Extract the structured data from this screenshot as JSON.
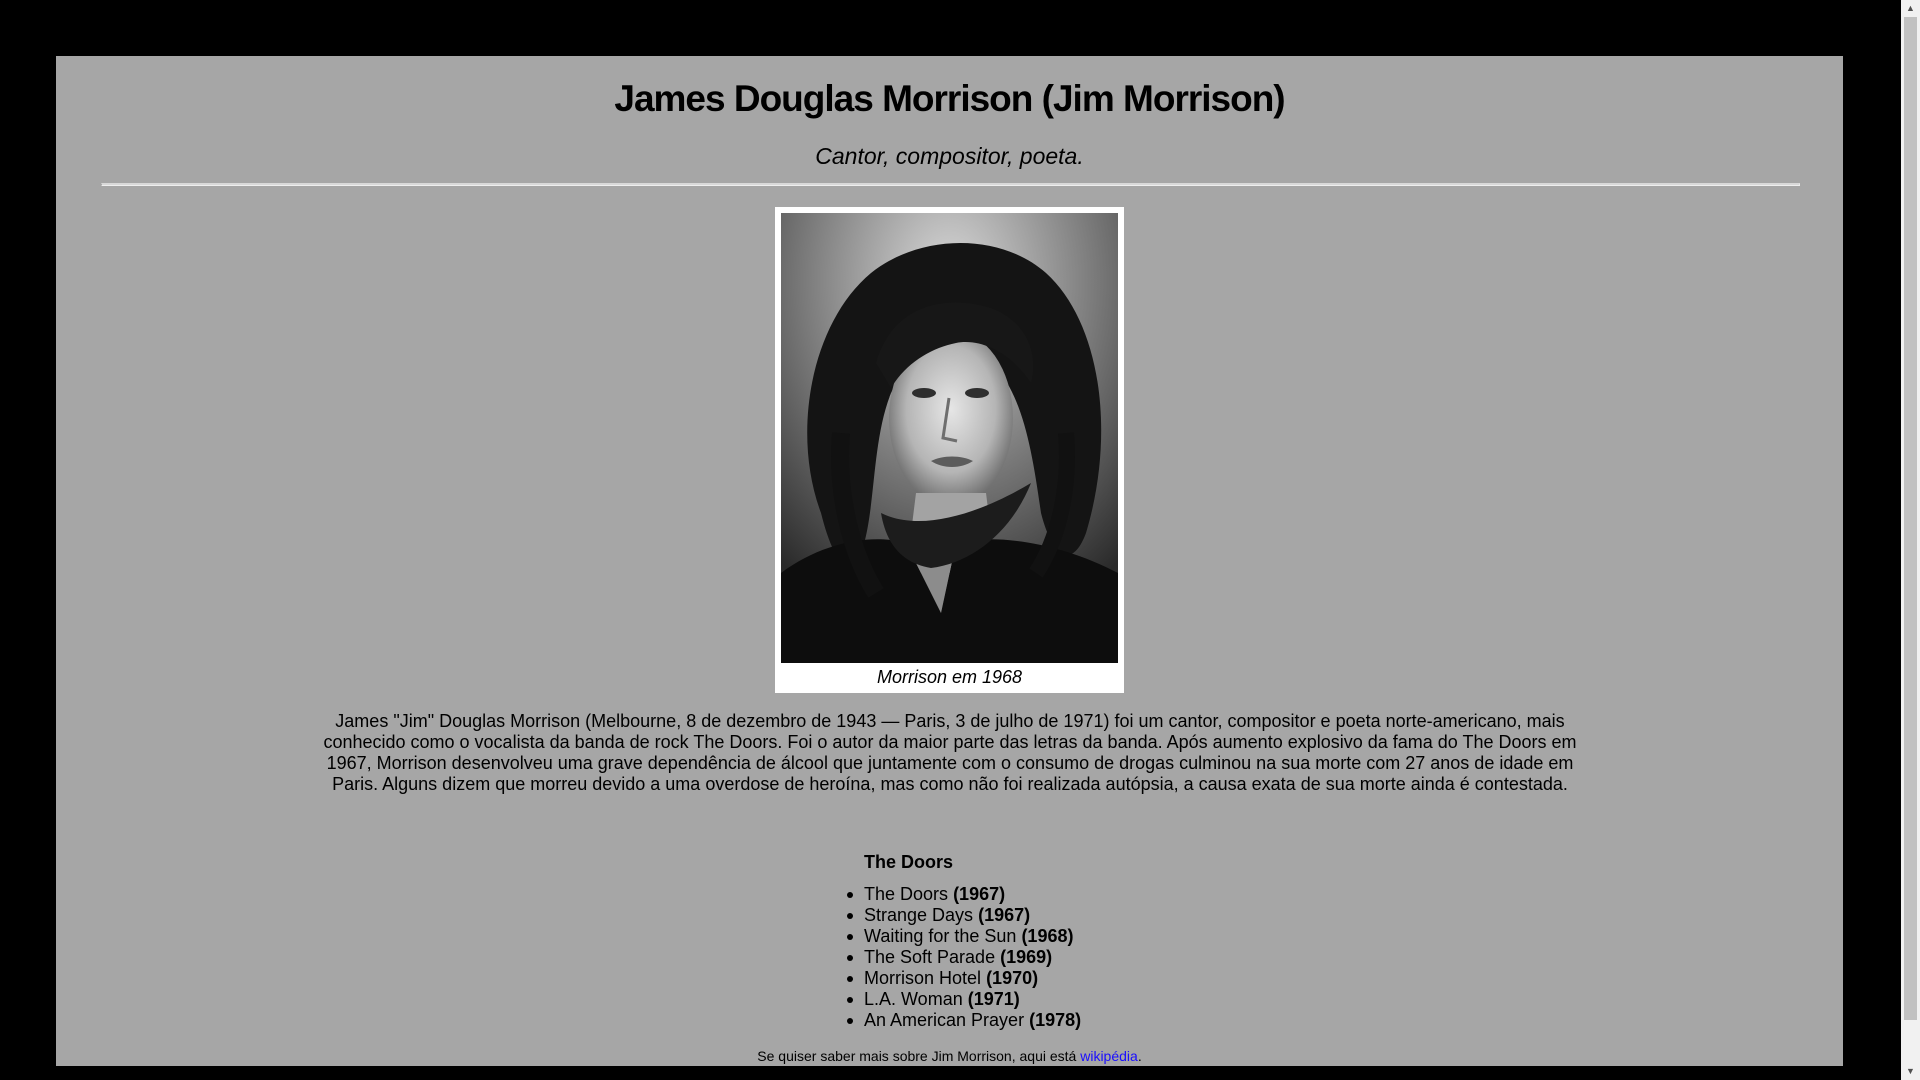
{
  "page": {
    "title": "James Douglas Morrison (Jim Morrison)",
    "subtitle": "Cantor, compositor, poeta."
  },
  "figure": {
    "caption": "Morrison em 1968",
    "image_alt": "Morrison em 1968"
  },
  "bio": {
    "text": "James \"Jim\" Douglas Morrison (Melbourne, 8 de dezembro de 1943 — Paris, 3 de julho de 1971) foi um cantor, compositor e poeta norte-americano, mais conhecido como o vocalista da banda de rock The Doors. Foi o autor da maior parte das letras da banda. Após aumento explosivo da fama do The Doors em 1967, Morrison desenvolveu uma grave dependência de álcool que juntamente com o consumo de drogas culminou na sua morte com 27 anos de idade em Paris. Alguns dizem que morreu devido a uma overdose de heroína, mas como não foi realizada autópsia, a causa exata de sua morte ainda é contestada."
  },
  "discography": {
    "heading": "The Doors",
    "albums": [
      {
        "name": "The Doors",
        "year": "(1967)"
      },
      {
        "name": "Strange Days",
        "year": "(1967)"
      },
      {
        "name": "Waiting for the Sun",
        "year": "(1968)"
      },
      {
        "name": "The Soft Parade",
        "year": "(1969)"
      },
      {
        "name": "Morrison Hotel",
        "year": "(1970)"
      },
      {
        "name": "L.A. Woman",
        "year": "(1971)"
      },
      {
        "name": "An American Prayer",
        "year": "(1978)"
      }
    ]
  },
  "footer": {
    "text": "Se quiser saber mais sobre Jim Morrison, aqui está ",
    "link_label": "wikipédia",
    "trailing": "."
  },
  "scrollbar": {
    "up_icon": "scroll-up-arrow-icon",
    "down_icon": "scroll-down-arrow-icon"
  },
  "colors": {
    "background": "#000000",
    "panel": "#a6a6a6",
    "link": "#1a0dff"
  }
}
